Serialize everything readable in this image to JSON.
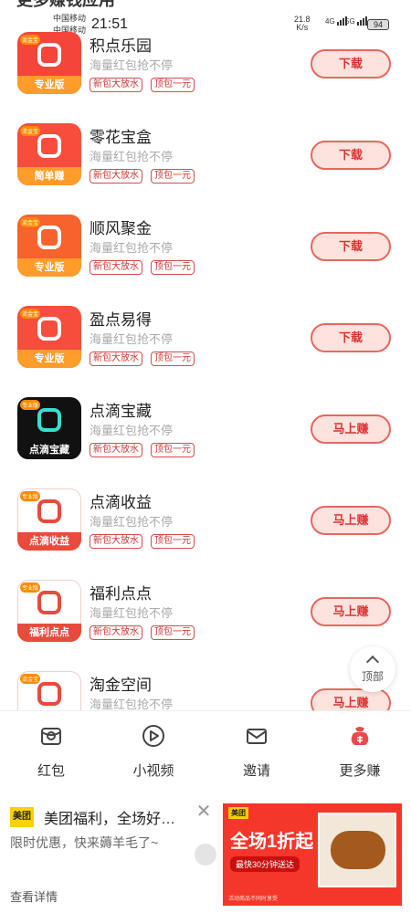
{
  "status_bar": {
    "page_title_partial": "更多赚钱应用",
    "carrier_1": "中国移动",
    "carrier_2": "中国移动",
    "time": "21:51",
    "net_speed_value": "21.8",
    "net_speed_unit": "K/s",
    "signal_1_label": "4G",
    "signal_2_label": "5G",
    "battery": "94"
  },
  "apps": [
    {
      "name": "积点乐园",
      "desc": "海量红包抢不停",
      "tag1": "新包大放水",
      "tag2": "顶包一元",
      "action": "下载",
      "icon_label": "专业版",
      "icon_color": "#f5443a",
      "band_color": "#ff9c2a"
    },
    {
      "name": "零花宝盒",
      "desc": "海量红包抢不停",
      "tag1": "新包大放水",
      "tag2": "顶包一元",
      "action": "下载",
      "icon_label": "简单赚",
      "icon_color": "#f84c3c",
      "band_color": "#ff9c2a"
    },
    {
      "name": "顺风聚金",
      "desc": "海量红包抢不停",
      "tag1": "新包大放水",
      "tag2": "顶包一元",
      "action": "下载",
      "icon_label": "专业版",
      "icon_color": "#f7622d",
      "band_color": "#ff9c2a"
    },
    {
      "name": "盈点易得",
      "desc": "海量红包抢不停",
      "tag1": "新包大放水",
      "tag2": "顶包一元",
      "action": "下载",
      "icon_label": "专业版",
      "icon_color": "#f74d3d",
      "band_color": "#ff9c2a"
    },
    {
      "name": "点滴宝藏",
      "desc": "海量红包抢不停",
      "tag1": "新包大放水",
      "tag2": "顶包一元",
      "action": "马上赚",
      "icon_label": "点滴宝藏",
      "icon_color": "#111111",
      "band_color": "#111111"
    },
    {
      "name": "点滴收益",
      "desc": "海量红包抢不停",
      "tag1": "新包大放水",
      "tag2": "顶包一元",
      "action": "马上赚",
      "icon_label": "点滴收益",
      "icon_color": "#ffffff",
      "band_color": "#e84a3c"
    },
    {
      "name": "福利点点",
      "desc": "海量红包抢不停",
      "tag1": "新包大放水",
      "tag2": "顶包一元",
      "action": "马上赚",
      "icon_label": "福利点点",
      "icon_color": "#ffffff",
      "band_color": "#e84a3c"
    },
    {
      "name": "淘金空间",
      "desc": "海量红包抢不停",
      "tag1": "新包大放水",
      "tag2": "顶包一元",
      "action": "马上赚",
      "icon_label": "",
      "icon_color": "#ffffff",
      "band_color": "#ffffff"
    }
  ],
  "icon_badges": [
    "流金宝",
    "流金宝",
    "流金宝",
    "流金宝",
    "专业版",
    "专业版",
    "专业版",
    "流金宝"
  ],
  "back_to_top": "顶部",
  "bottom_nav": [
    {
      "label": "红包",
      "icon": "red-packet-icon"
    },
    {
      "label": "小视频",
      "icon": "play-icon"
    },
    {
      "label": "邀请",
      "icon": "invite-icon"
    },
    {
      "label": "更多赚",
      "icon": "more-earn-icon"
    }
  ],
  "ad": {
    "brand": "美团",
    "title": "美团福利，全场好…",
    "close": "✕",
    "subtitle": "限时优惠，快来薅羊毛了~",
    "more": "查看详情",
    "banner_brand": "美团",
    "banner_headline": "全场1折起",
    "banner_sub": "最快30分钟送达",
    "banner_fine": "活动商品不同时享受"
  },
  "colors": {
    "accent": "#e86660",
    "button_bg": "#fde3de",
    "tag_border": "#d84b4b",
    "nav_active": "#e94b4b"
  }
}
